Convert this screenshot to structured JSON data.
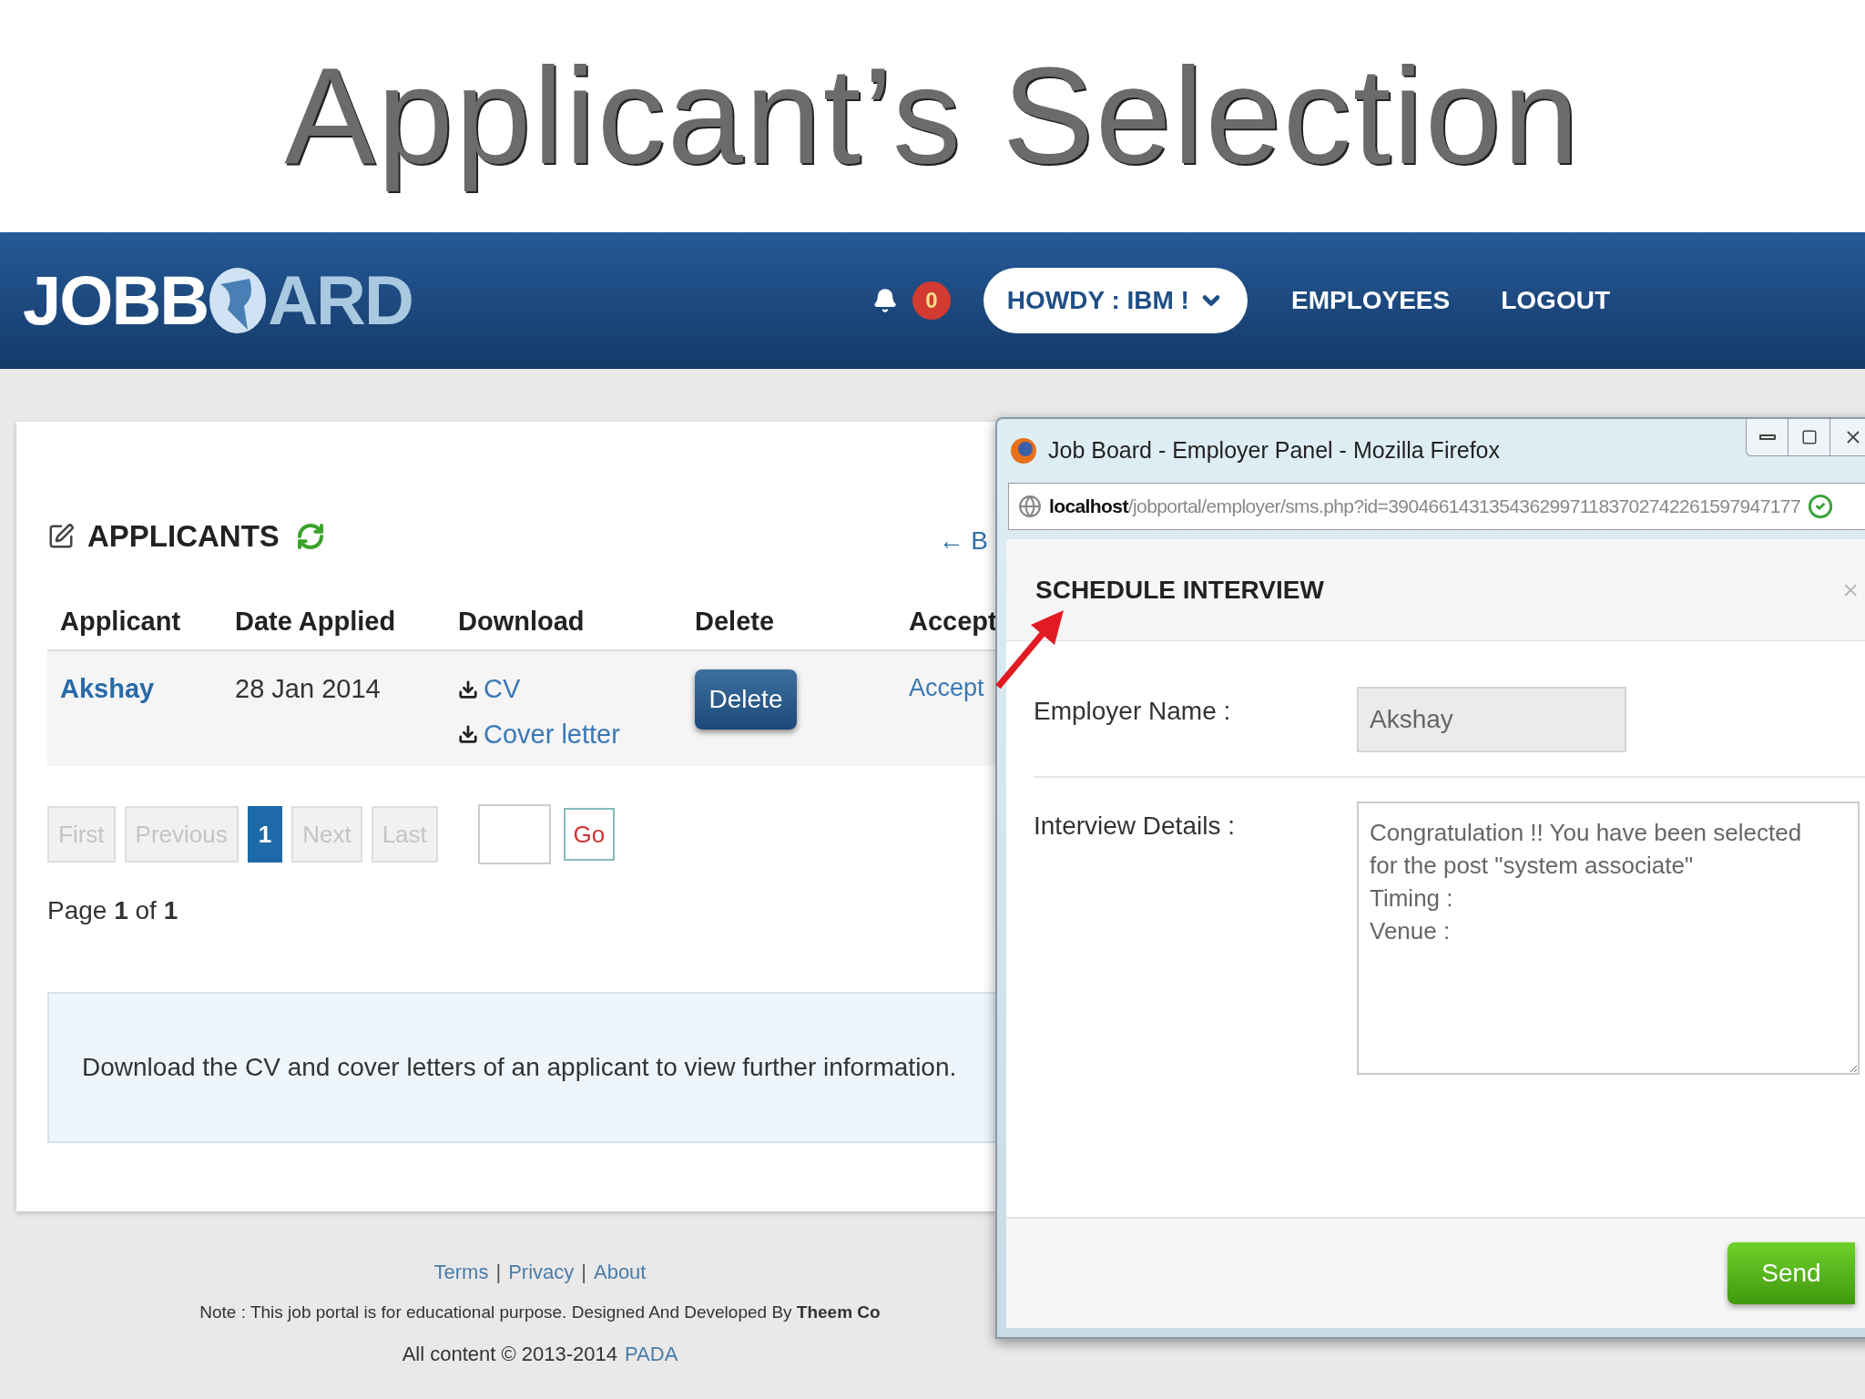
{
  "slide_title": "Applicant’s Selection",
  "navbar": {
    "logo_left": "JOBB",
    "logo_right": "ARD",
    "notification_count": "0",
    "user_menu": "HOWDY : IBM !",
    "links": [
      "EMPLOYEES",
      "LOGOUT"
    ]
  },
  "applicants_panel": {
    "heading": "APPLICANTS",
    "back_link": "← B",
    "columns": [
      "Applicant",
      "Date Applied",
      "Download",
      "Delete",
      "Accept"
    ],
    "rows": [
      {
        "applicant": "Akshay",
        "date_applied": "28 Jan 2014",
        "downloads": [
          "CV",
          "Cover letter"
        ],
        "delete": "Delete",
        "accept": "Accept"
      }
    ],
    "pagination": [
      {
        "label": "First",
        "selected": false,
        "disabled": true
      },
      {
        "label": "Previous",
        "selected": false,
        "disabled": true
      },
      {
        "label": "1",
        "selected": true,
        "disabled": false
      },
      {
        "label": "Next",
        "selected": false,
        "disabled": true
      },
      {
        "label": "Last",
        "selected": false,
        "disabled": true
      }
    ],
    "go_button": "Go",
    "page_info": "Page **1** of **1**",
    "info": "Download the CV and cover letters of an applicant to view further information."
  },
  "footer": {
    "links": [
      "Terms",
      "Privacy",
      "About"
    ],
    "separator": "|",
    "note": "Note : This job portal is for educational purpose. Designed And Developed By **Theem Co**",
    "copyright": "All content © 2013-2014",
    "copyright_link": "PADA"
  },
  "popup": {
    "window_title": "Job Board - Employer Panel - Mozilla Firefox",
    "url_host": "localhost",
    "url_path": "/jobportal/employer/sms.php?id=39046614313543629971183702742261597947177",
    "dialog_title": "SCHEDULE INTERVIEW",
    "close_symbol": "×",
    "fields": [
      {
        "label": "Employer Name :",
        "kind": "input",
        "value": "Akshay"
      },
      {
        "label": "Interview Details :",
        "kind": "textarea",
        "value": "Congratulation !! You have been selected\nfor the post \"system associate\"\nTiming :\nVenue :"
      }
    ],
    "send_button": "Send"
  }
}
